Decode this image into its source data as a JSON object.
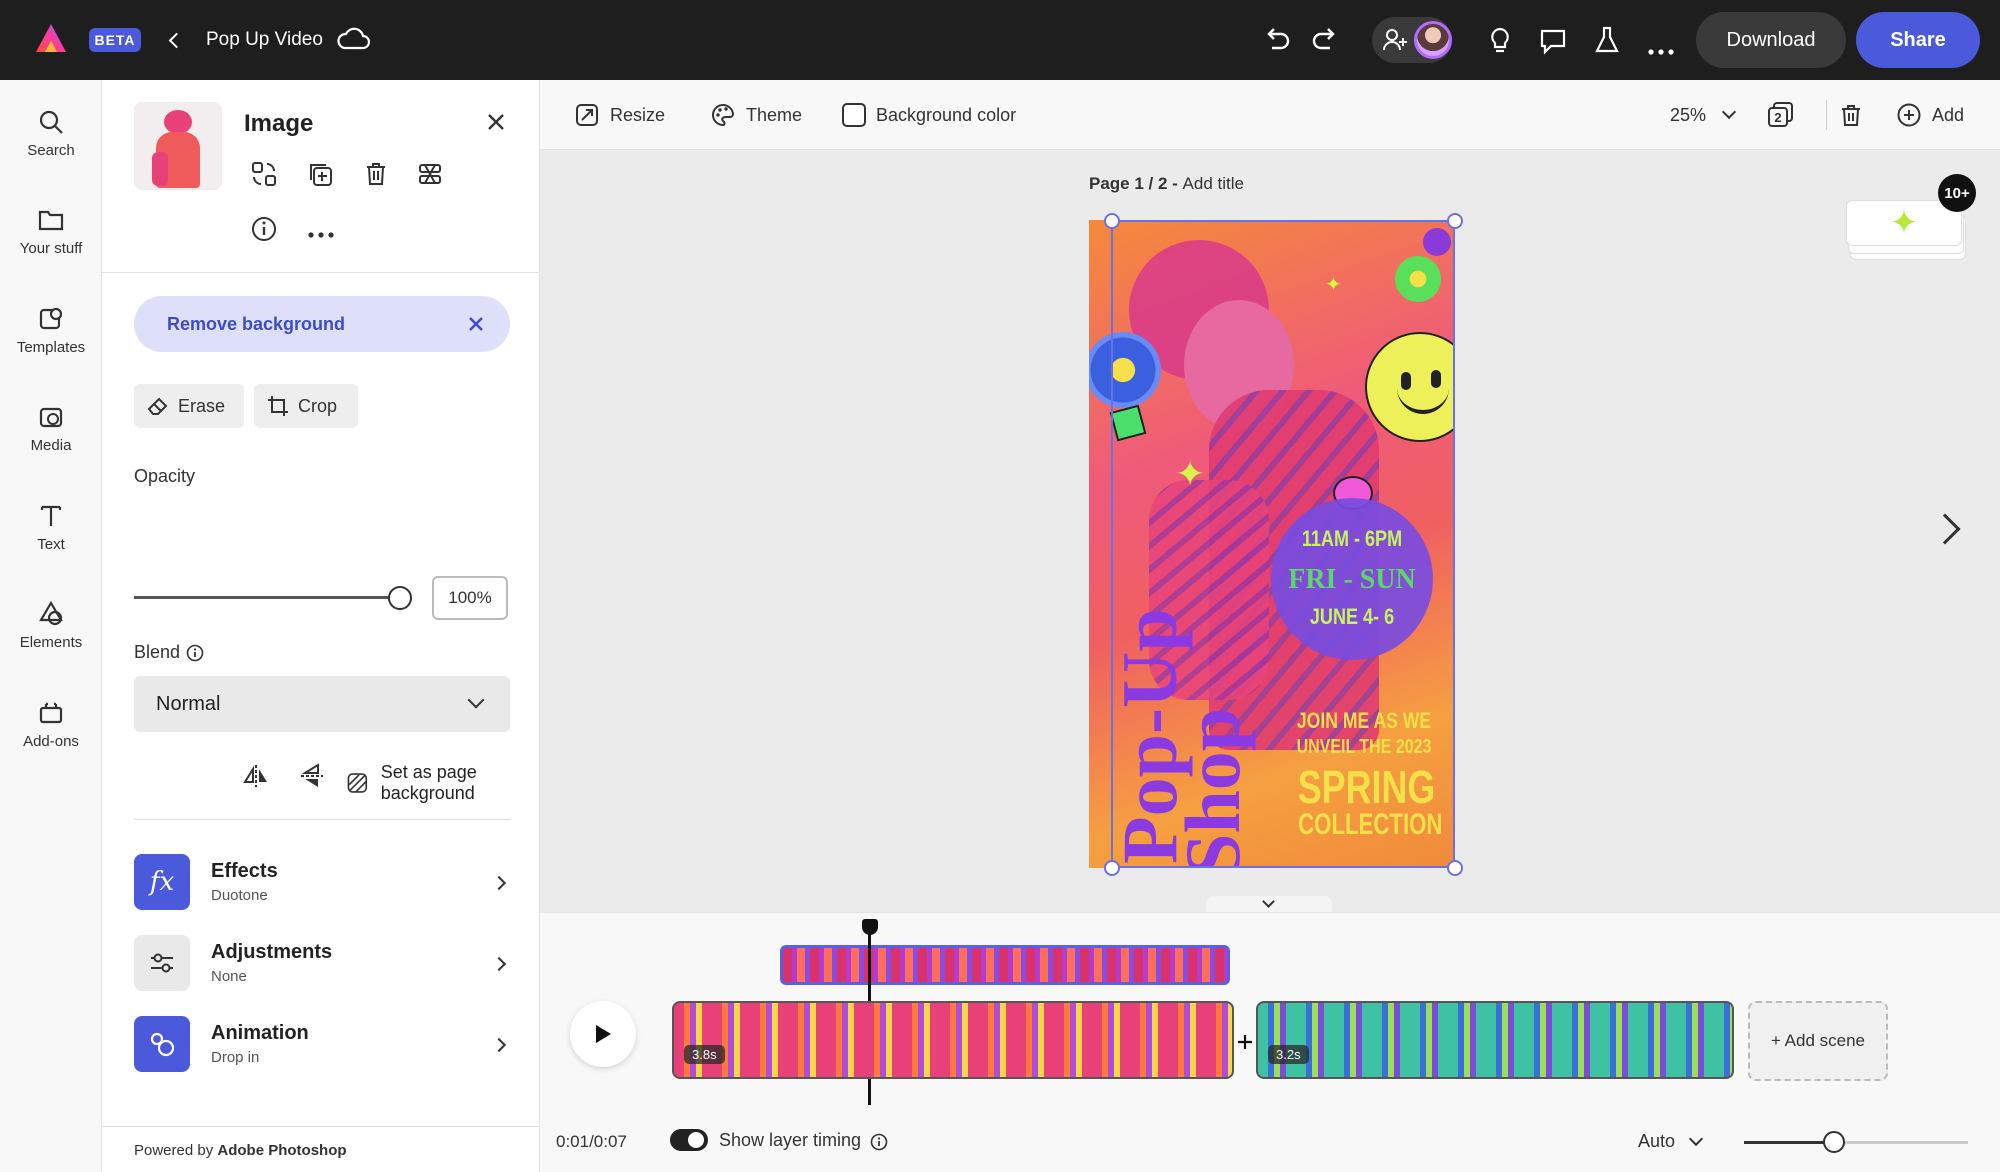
{
  "app": {
    "beta_badge": "BETA",
    "project_title": "Pop Up Video",
    "download_label": "Download",
    "share_label": "Share",
    "accent": "#4b5adb"
  },
  "rail": {
    "items": [
      {
        "label": "Search",
        "icon": "search-icon"
      },
      {
        "label": "Your stuff",
        "icon": "folder-icon"
      },
      {
        "label": "Templates",
        "icon": "templates-icon"
      },
      {
        "label": "Media",
        "icon": "media-icon"
      },
      {
        "label": "Text",
        "icon": "text-icon"
      },
      {
        "label": "Elements",
        "icon": "elements-icon"
      },
      {
        "label": "Add-ons",
        "icon": "addons-icon"
      }
    ]
  },
  "panel": {
    "title": "Image",
    "remove_bg_label": "Remove background",
    "erase_label": "Erase",
    "crop_label": "Crop",
    "opacity_label": "Opacity",
    "opacity_value": "100%",
    "opacity_fraction": 1.0,
    "blend_label": "Blend",
    "blend_value": "Normal",
    "set_bg_label": "Set as page background",
    "rows": [
      {
        "title": "Effects",
        "sub": "Duotone",
        "icon": "fx-icon"
      },
      {
        "title": "Adjustments",
        "sub": "None",
        "icon": "sliders-icon"
      },
      {
        "title": "Animation",
        "sub": "Drop in",
        "icon": "animation-icon"
      }
    ],
    "powered_prefix": "Powered by ",
    "powered_brand": "Adobe Photoshop"
  },
  "toolbar": {
    "resize_label": "Resize",
    "theme_label": "Theme",
    "bg_color_label": "Background color",
    "zoom_value": "25%",
    "pages_count": "2",
    "add_label": "Add"
  },
  "canvas": {
    "page_label": "Page 1 / 2 - ",
    "add_title_label": "Add title",
    "badge_count": "10+",
    "poster": {
      "vertical_text_1": "Pop-Up",
      "vertical_text_2": "Shop",
      "time": "11AM - 6PM",
      "days": "FRI - SUN",
      "dates": "JUNE 4- 6",
      "line1": "JOIN ME AS WE",
      "line2": "UNVEIL THE 2023",
      "line3": "SPRING",
      "line4": "COLLECTION"
    }
  },
  "timeline": {
    "scene1_duration": "3.8s",
    "scene2_duration": "3.2s",
    "add_scene_label": "+ Add scene",
    "time_current": "0:01/0:07",
    "show_layer_timing_label": "Show layer timing",
    "auto_label": "Auto",
    "zoom_fraction": 0.4
  }
}
